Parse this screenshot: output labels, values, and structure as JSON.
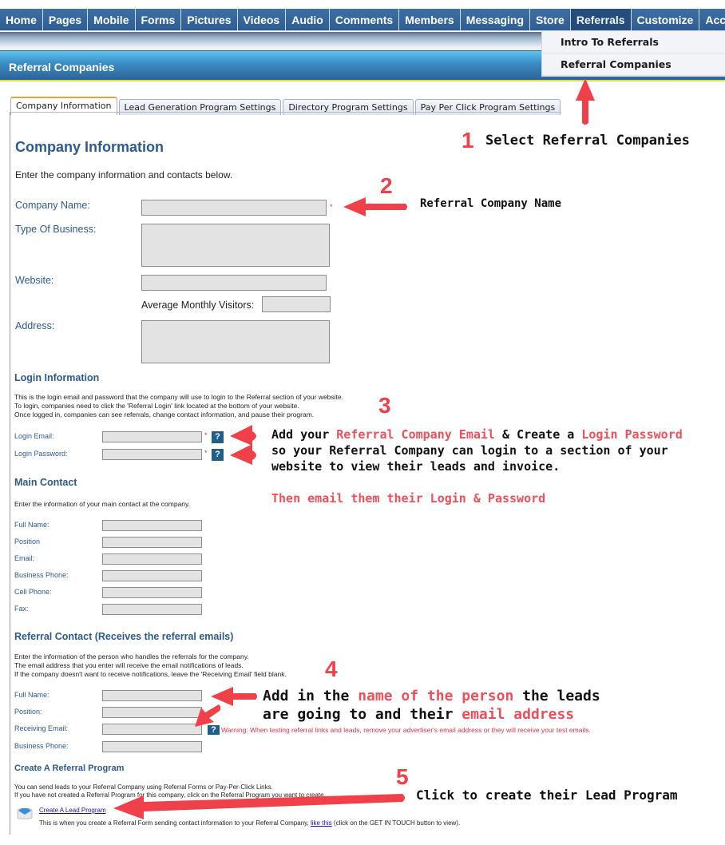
{
  "nav": {
    "items": [
      "Home",
      "Pages",
      "Mobile",
      "Forms",
      "Pictures",
      "Videos",
      "Audio",
      "Comments",
      "Members",
      "Messaging",
      "Store",
      "Referrals",
      "Customize",
      "Account"
    ],
    "active": "Referrals",
    "dropdown": [
      "Intro To Referrals",
      "Referral Companies"
    ]
  },
  "page_title": "Referral Companies",
  "tabs": [
    "Company Information",
    "Lead Generation Program Settings",
    "Directory Program Settings",
    "Pay Per Click Program Settings"
  ],
  "company_info": {
    "heading": "Company Information",
    "intro": "Enter the company information and contacts below.",
    "labels": {
      "company_name": "Company Name:",
      "type_of_business": "Type Of Business:",
      "website": "Website:",
      "avg_visitors": "Average Monthly Visitors:",
      "address": "Address:"
    },
    "required_mark": "*"
  },
  "login_info": {
    "heading": "Login Information",
    "desc": [
      "This is the login email and password that the company will use to login to the Referral section of your website.",
      "To login, companies need to click the 'Referral Login' link located at the bottom of your website.",
      "Once logged in, companies can see referrals, change contact information, and pause their program."
    ],
    "labels": {
      "email": "Login Email:",
      "password": "Login Password:"
    },
    "help_glyph": "?"
  },
  "main_contact": {
    "heading": "Main Contact",
    "desc": "Enter the information of your main contact at the company.",
    "labels": [
      "Full Name:",
      "Position",
      "Email:",
      "Business Phone:",
      "Cell Phone:",
      "Fax:"
    ]
  },
  "referral_contact": {
    "heading": "Referral Contact (Receives the referral emails)",
    "desc": [
      "Enter the information of the person who handles the referrals for the company.",
      "The email address that you enter will receive the email notifications of leads.",
      "If the company doesn't want to receive notifications, leave the 'Receiving Email' field blank."
    ],
    "labels": [
      "Full Name:",
      "Position:",
      "Receiving Email:",
      "Business Phone:"
    ],
    "warning": "Warning: When testing referral links and leads, remove your advertiser's email address or they will receive your test emails."
  },
  "create_program": {
    "heading": "Create A Referral Program",
    "desc": [
      "You can send leads to your Referral Company using Referral Forms or Pay-Per-Click Links.",
      "If you have not created a Referral Program for this company, click on the Referral Program you want to create."
    ],
    "link": "Create A Lead Program",
    "link_desc_before": "This is when you create a Referral Form sending contact information to your Referral Company, ",
    "link_inline": "like this",
    "link_desc_after": " (click on the GET IN TOUCH button to view)."
  },
  "annotations": {
    "step1": {
      "num": "1",
      "text": "Select Referral Companies"
    },
    "step2": {
      "num": "2",
      "text": "Referral Company Name"
    },
    "step3": {
      "num": "3",
      "l1a": "Add your ",
      "l1b": "Referral Company Email",
      "l1c": " & Create a ",
      "l1d": "Login Password",
      "l2": "so your Referral Company can login to a section of your",
      "l3": "website to view their leads and invoice.",
      "l4": "Then email them their Login & Password"
    },
    "step4": {
      "num": "4",
      "l1a": "Add in the ",
      "l1b": "name of the person",
      "l1c": " the leads",
      "l2a": "are going to and their ",
      "l2b": "email address"
    },
    "step5": {
      "num": "5",
      "text": "Click to create their Lead Program"
    }
  },
  "colors": {
    "nav_blue": "#2e5d93",
    "heading_blue": "#2c5a8c",
    "annotation_red": "#f04049",
    "field_gray": "#e3e3e3"
  }
}
